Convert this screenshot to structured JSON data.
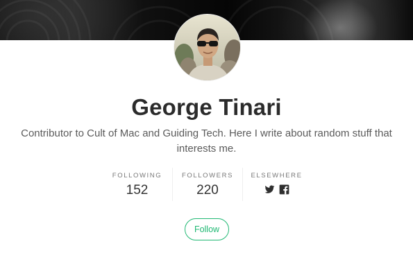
{
  "profile": {
    "name": "George Tinari",
    "bio": "Contributor to Cult of Mac and Guiding Tech. Here I write about random stuff that interests me."
  },
  "stats": {
    "following": {
      "label": "FOLLOWING",
      "value": "152"
    },
    "followers": {
      "label": "FOLLOWERS",
      "value": "220"
    },
    "elsewhere": {
      "label": "ELSEWHERE",
      "icons": [
        "twitter-icon",
        "facebook-icon"
      ]
    }
  },
  "actions": {
    "follow_label": "Follow"
  },
  "colors": {
    "accent": "#1fb873",
    "name_text": "#2b2b2b",
    "bio_text": "#5a5a5a"
  }
}
